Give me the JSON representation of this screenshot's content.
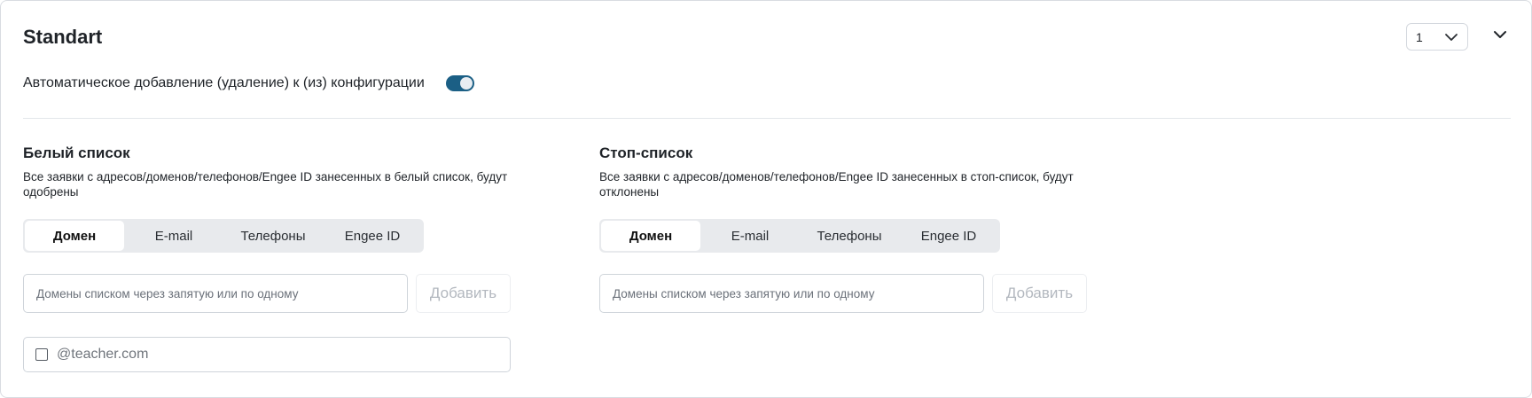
{
  "header": {
    "title": "Standart",
    "version_value": "1"
  },
  "auto_config": {
    "label": "Автоматическое добавление (удаление) к (из) конфигурации",
    "enabled": true
  },
  "whitelist": {
    "title": "Белый список",
    "description": "Все заявки с адресов/доменов/телефонов/Engee ID занесенных в белый список, будут одобрены",
    "tabs": [
      "Домен",
      "E-mail",
      "Телефоны",
      "Engee ID"
    ],
    "active_tab": "Домен",
    "input_placeholder": "Домены списком через запятую или по одному",
    "add_label": "Добавить",
    "items": [
      "@teacher.com"
    ]
  },
  "stoplist": {
    "title": "Стоп-список",
    "description": "Все заявки с адресов/доменов/телефонов/Engee ID занесенных в стоп-список, будут отклонены",
    "tabs": [
      "Домен",
      "E-mail",
      "Телефоны",
      "Engee ID"
    ],
    "active_tab": "Домен",
    "input_placeholder": "Домены списком через запятую или по одному",
    "add_label": "Добавить"
  },
  "colors": {
    "toggle_on": "#1b5f85",
    "tabs_bg": "#e8eaed",
    "border": "#cfd4da"
  },
  "icons": {
    "version_select": "chevron-down-icon",
    "collapse": "chevron-down-icon"
  }
}
